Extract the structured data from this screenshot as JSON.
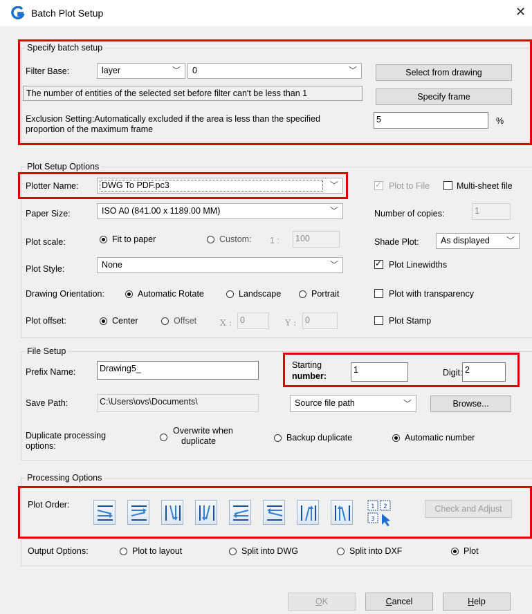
{
  "title": "Batch Plot Setup",
  "batch": {
    "legend": "Specify batch setup",
    "filter_base_label": "Filter Base:",
    "filter_field": "layer",
    "filter_value": "0",
    "select_from_drawing": "Select from drawing",
    "warning_text": "The number of entities of the selected set before filter can't be less than 1",
    "specify_frame": "Specify frame",
    "exclusion_line1": "Exclusion Setting:Automatically excluded if the area is less than the specified",
    "exclusion_line2": "proportion of the maximum frame",
    "exclusion_value": "5",
    "exclusion_unit": "%"
  },
  "plot": {
    "legend": "Plot Setup Options",
    "plotter_label": "Plotter Name:",
    "plotter_value": "DWG To PDF.pc3",
    "plot_to_file": "Plot to File",
    "multi_sheet": "Multi-sheet file",
    "paper_label": "Paper Size:",
    "paper_value": "ISO A0 (841.00 x 1189.00 MM)",
    "copies_label": "Number of copies:",
    "copies_value": "1",
    "scale_label": "Plot scale:",
    "fit_to_paper": "Fit to paper",
    "custom": "Custom:",
    "ratio_prefix": "1 :",
    "custom_value": "100",
    "shade_label": "Shade Plot:",
    "shade_value": "As displayed",
    "style_label": "Plot Style:",
    "style_value": "None",
    "linewidths": "Plot Linewidths",
    "orientation_label": "Drawing Orientation:",
    "auto_rotate": "Automatic Rotate",
    "landscape": "Landscape",
    "portrait": "Portrait",
    "transparency": "Plot with transparency",
    "offset_label": "Plot offset:",
    "center": "Center",
    "offset": "Offset",
    "x_label": "X :",
    "x_value": "0",
    "y_label": "Y :",
    "y_value": "0",
    "stamp": "Plot Stamp"
  },
  "file": {
    "legend": "File Setup",
    "prefix_label": "Prefix Name:",
    "prefix_value": "Drawing5_",
    "starting_label_1": "Starting",
    "starting_label_2": "number:",
    "starting_value": "1",
    "digit_label": "Digit:",
    "digit_value": "2",
    "save_label": "Save Path:",
    "save_value": "C:\\Users\\ovs\\Documents\\",
    "source_value": "Source file path",
    "browse": "Browse...",
    "dup_label_1": "Duplicate processing",
    "dup_label_2": "options:",
    "overwrite_1": "Overwrite when",
    "overwrite_2": "duplicate",
    "backup": "Backup duplicate",
    "auto_number": "Automatic number"
  },
  "processing": {
    "legend": "Processing Options",
    "order_label": "Plot Order:",
    "check_adjust": "Check and Adjust",
    "output_label": "Output Options:",
    "to_layout": "Plot to layout",
    "split_dwg": "Split into DWG",
    "split_dxf": "Split into DXF",
    "plot": "Plot"
  },
  "buttons": {
    "ok_u": "O",
    "ok_rest": "K",
    "cancel_u": "C",
    "cancel_rest": "ancel",
    "help_u": "H",
    "help_rest": "elp"
  },
  "colors": {
    "highlight": "#e00000",
    "accent": "#1c6fd1"
  }
}
